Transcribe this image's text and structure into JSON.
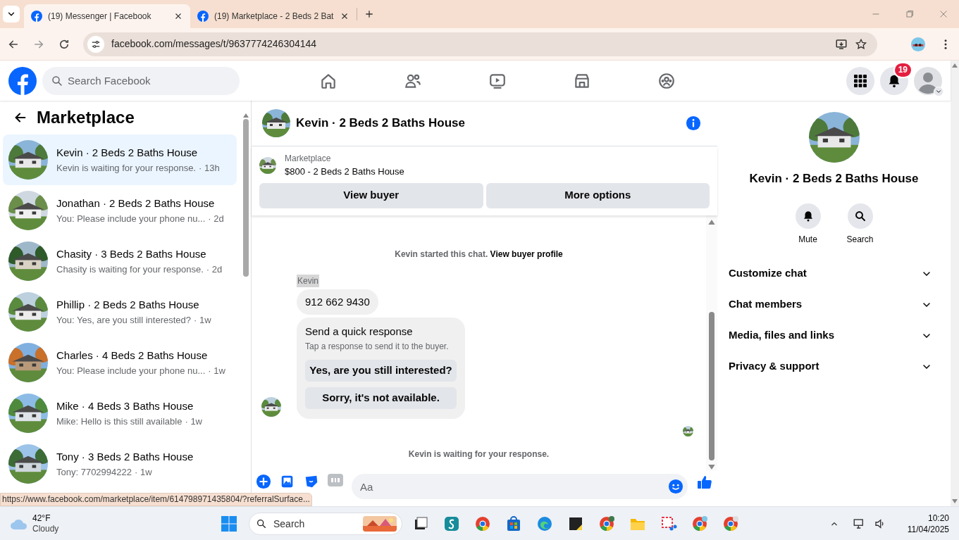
{
  "browser": {
    "tabs": [
      {
        "title": "(19) Messenger | Facebook",
        "selected": true
      },
      {
        "title": "(19) Marketplace - 2 Beds 2 Bat",
        "selected": false
      }
    ],
    "url": "facebook.com/messages/t/9637774246304144"
  },
  "header": {
    "search_placeholder": "Search Facebook",
    "notification_count": "19"
  },
  "sidebar": {
    "title": "Marketplace",
    "conversations": [
      {
        "name": "Kevin · 2 Beds 2 Baths House",
        "preview": "Kevin is waiting for your response.",
        "time": "· 13h",
        "selected": true
      },
      {
        "name": "Jonathan · 2 Beds 2 Baths House",
        "preview": "You: Please include your phone nu...",
        "time": "· 2d",
        "selected": false
      },
      {
        "name": "Chasity · 3 Beds 2 Baths House",
        "preview": "Chasity is waiting for your response.",
        "time": "· 2d",
        "selected": false
      },
      {
        "name": "Phillip · 2 Beds 2 Baths House",
        "preview": "You: Yes, are you still interested?",
        "time": "· 1w",
        "selected": false
      },
      {
        "name": "Charles · 4 Beds 2 Baths House",
        "preview": "You: Please include your phone nu...",
        "time": "· 1w",
        "selected": false
      },
      {
        "name": "Mike · 4 Beds 3 Baths House",
        "preview": "Mike: Hello is this still available",
        "time": "· 1w",
        "selected": false
      },
      {
        "name": "Tony · 3 Beds 2 Baths House",
        "preview": "Tony: 7702994222",
        "time": "· 1w",
        "selected": false
      }
    ]
  },
  "chat": {
    "title": "Kevin · 2 Beds 2 Baths House",
    "listing": {
      "label": "Marketplace",
      "title": "$800 - 2 Beds 2 Baths House"
    },
    "buttons": [
      "View buyer",
      "More options"
    ],
    "system_note": {
      "text": "Kevin started this chat.",
      "link": "View buyer profile"
    },
    "sender": "Kevin",
    "message": "912 662 9430",
    "quick_response": {
      "title": "Send a quick response",
      "subtitle": "Tap a response to send it to the buyer.",
      "options": [
        "Yes, are you still interested?",
        "Sorry, it's not available."
      ]
    },
    "waiting": "Kevin is waiting for your response.",
    "composer_placeholder": "Aa"
  },
  "details": {
    "title": "Kevin · 2 Beds 2 Baths House",
    "actions": [
      {
        "kind": "mute",
        "label": "Mute"
      },
      {
        "kind": "search",
        "label": "Search"
      }
    ],
    "sections": [
      "Customize chat",
      "Chat members",
      "Media, files and links",
      "Privacy & support"
    ]
  },
  "status_url": "https://www.facebook.com/marketplace/item/614798971435804/?referralSurface...",
  "taskbar": {
    "weather": {
      "temp": "42°F",
      "condition": "Cloudy"
    },
    "search_placeholder": "Search",
    "time": "10:20",
    "date": "11/04/2025"
  }
}
